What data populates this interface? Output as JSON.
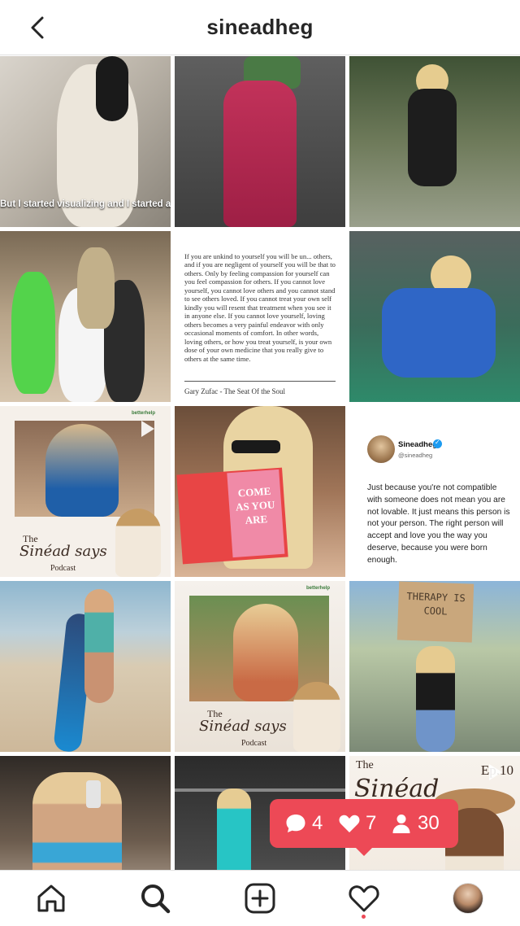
{
  "header": {
    "title": "sineadheg",
    "back_icon": "chevron-left-icon"
  },
  "grid": {
    "tile1_caption": "But I started visualizing and I started asking",
    "quote": {
      "text": "If you are unkind to yourself you will be un... others, and if you are negligent of yourself you will be that to others. Only by feeling compassion for yourself can you feel compassion for others. If you cannot love yourself, you cannot love others and you cannot stand to see others loved. If you cannot treat your own self kindly you will resent that treatment when you see it in anyone else. If you cannot love yourself, loving others becomes a very painful endeavor with only occasional moments of comfort. In other words, loving others, or how you treat yourself, is your own dose of your own medicine that you really give to others at the same time.",
      "author": "Gary Zufac - The Seat Of the Soul"
    },
    "podcast": {
      "brand": "betterhelp",
      "title_line1": "The",
      "title_script": "Sinéad says",
      "subtitle": "Podcast"
    },
    "book_title": "COME AS YOU ARE",
    "tweet": {
      "name": "Sineadheg",
      "handle": "@sineadheg",
      "body": "Just because you're not compatible with someone does not mean you are not lovable. It just means this person is not your person. The right person will accept and love you the way you deserve, because you were born enough."
    },
    "sign_text": "THERAPY IS COOL",
    "episode_label": "Ep.10"
  },
  "notifications": {
    "comments": "4",
    "likes": "7",
    "followers": "30",
    "color": "#ed4956"
  },
  "nav": {
    "items": [
      "home-icon",
      "search-icon",
      "add-post-icon",
      "activity-heart-icon",
      "profile-avatar"
    ],
    "accent": "#ed4956"
  }
}
